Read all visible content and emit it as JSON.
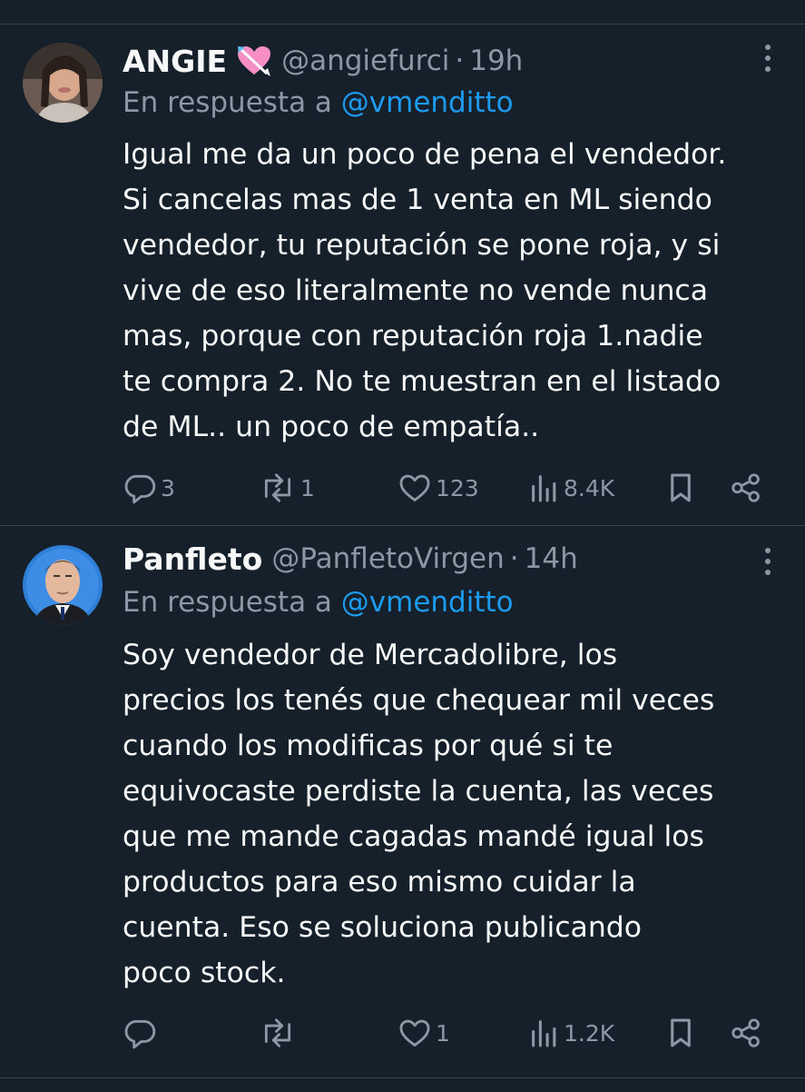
{
  "tweets": [
    {
      "name": "ANGIE",
      "emoji": "heart-with-arrow",
      "handle": "@angiefurci",
      "dot": "·",
      "time": "19h",
      "reply_prefix": "En respuesta a ",
      "reply_to": "@vmenditto",
      "lines": [
        "Igual me da un poco de pena el vendedor.",
        "Si cancelas mas de 1 venta en ML siendo",
        "vendedor, tu reputación se pone roja, y si",
        "vive de eso literalmente no vende nunca",
        "mas, porque con reputación roja 1.nadie",
        "te compra 2. No te muestran en el listado",
        "de ML.. un poco de empatía.."
      ],
      "replies": "3",
      "retweets": "1",
      "likes": "123",
      "views": "8.4K"
    },
    {
      "name": "Panfleto",
      "handle": "@PanfletoVirgen",
      "dot": "·",
      "time": "14h",
      "reply_prefix": "En respuesta a ",
      "reply_to": "@vmenditto",
      "lines": [
        "Soy vendedor de Mercadolibre, los",
        "precios los tenés que chequear mil veces",
        "cuando los modificas por qué si te",
        "equivocaste perdiste la cuenta, las veces",
        "que me mande cagadas mandé igual los",
        "productos para eso mismo cuidar la",
        "cuenta. Eso se soluciona publicando",
        "poco stock."
      ],
      "replies": "",
      "retweets": "",
      "likes": "1",
      "views": "1.2K"
    }
  ],
  "colors": {
    "background": "#15202b",
    "text": "#f7f9f9",
    "muted": "#8b98a5",
    "link": "#1d9bf0",
    "divider": "#38444d"
  },
  "icons": [
    "reply-icon",
    "retweet-icon",
    "like-icon",
    "views-icon",
    "bookmark-icon",
    "share-icon",
    "more-icon"
  ]
}
